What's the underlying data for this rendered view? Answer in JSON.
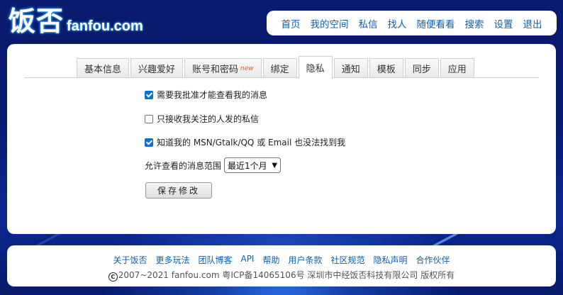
{
  "brand": {
    "cn": "饭否",
    "en": "fanfou.com"
  },
  "nav": [
    "首页",
    "我的空间",
    "私信",
    "找人",
    "随便看看",
    "搜索",
    "设置",
    "退出"
  ],
  "tabs": [
    {
      "label": "基本信息"
    },
    {
      "label": "兴趣爱好"
    },
    {
      "label": "账号和密码",
      "badge": "new"
    },
    {
      "label": "绑定"
    },
    {
      "label": "隐私",
      "active": true
    },
    {
      "label": "通知"
    },
    {
      "label": "模板"
    },
    {
      "label": "同步"
    },
    {
      "label": "应用"
    }
  ],
  "privacy": {
    "opt1": {
      "label": "需要我批准才能查看我的消息",
      "checked": true
    },
    "opt2": {
      "label": "只接收我关注的人发的私信",
      "checked": false
    },
    "opt3": {
      "label": "知道我的 MSN/Gtalk/QQ 或 Email 也没法找到我",
      "checked": true
    },
    "range_label": "允许查看的消息范围",
    "range_value": "最近1个月",
    "save_label": "保存修改"
  },
  "footer": {
    "links": [
      "关于饭否",
      "更多玩法",
      "团队博客",
      "API",
      "帮助",
      "用户条款",
      "社区规范",
      "隐私声明",
      "合作伙伴"
    ],
    "copyright_symbol": "C",
    "copyright": "2007~2021 fanfou.com  粤ICP备14065106号 深圳市中经饭否科技有限公司 版权所有"
  },
  "colors": {
    "link": "#0f5fa8",
    "checkbox": "#0b6fd9",
    "background": "#0a1a6e"
  }
}
